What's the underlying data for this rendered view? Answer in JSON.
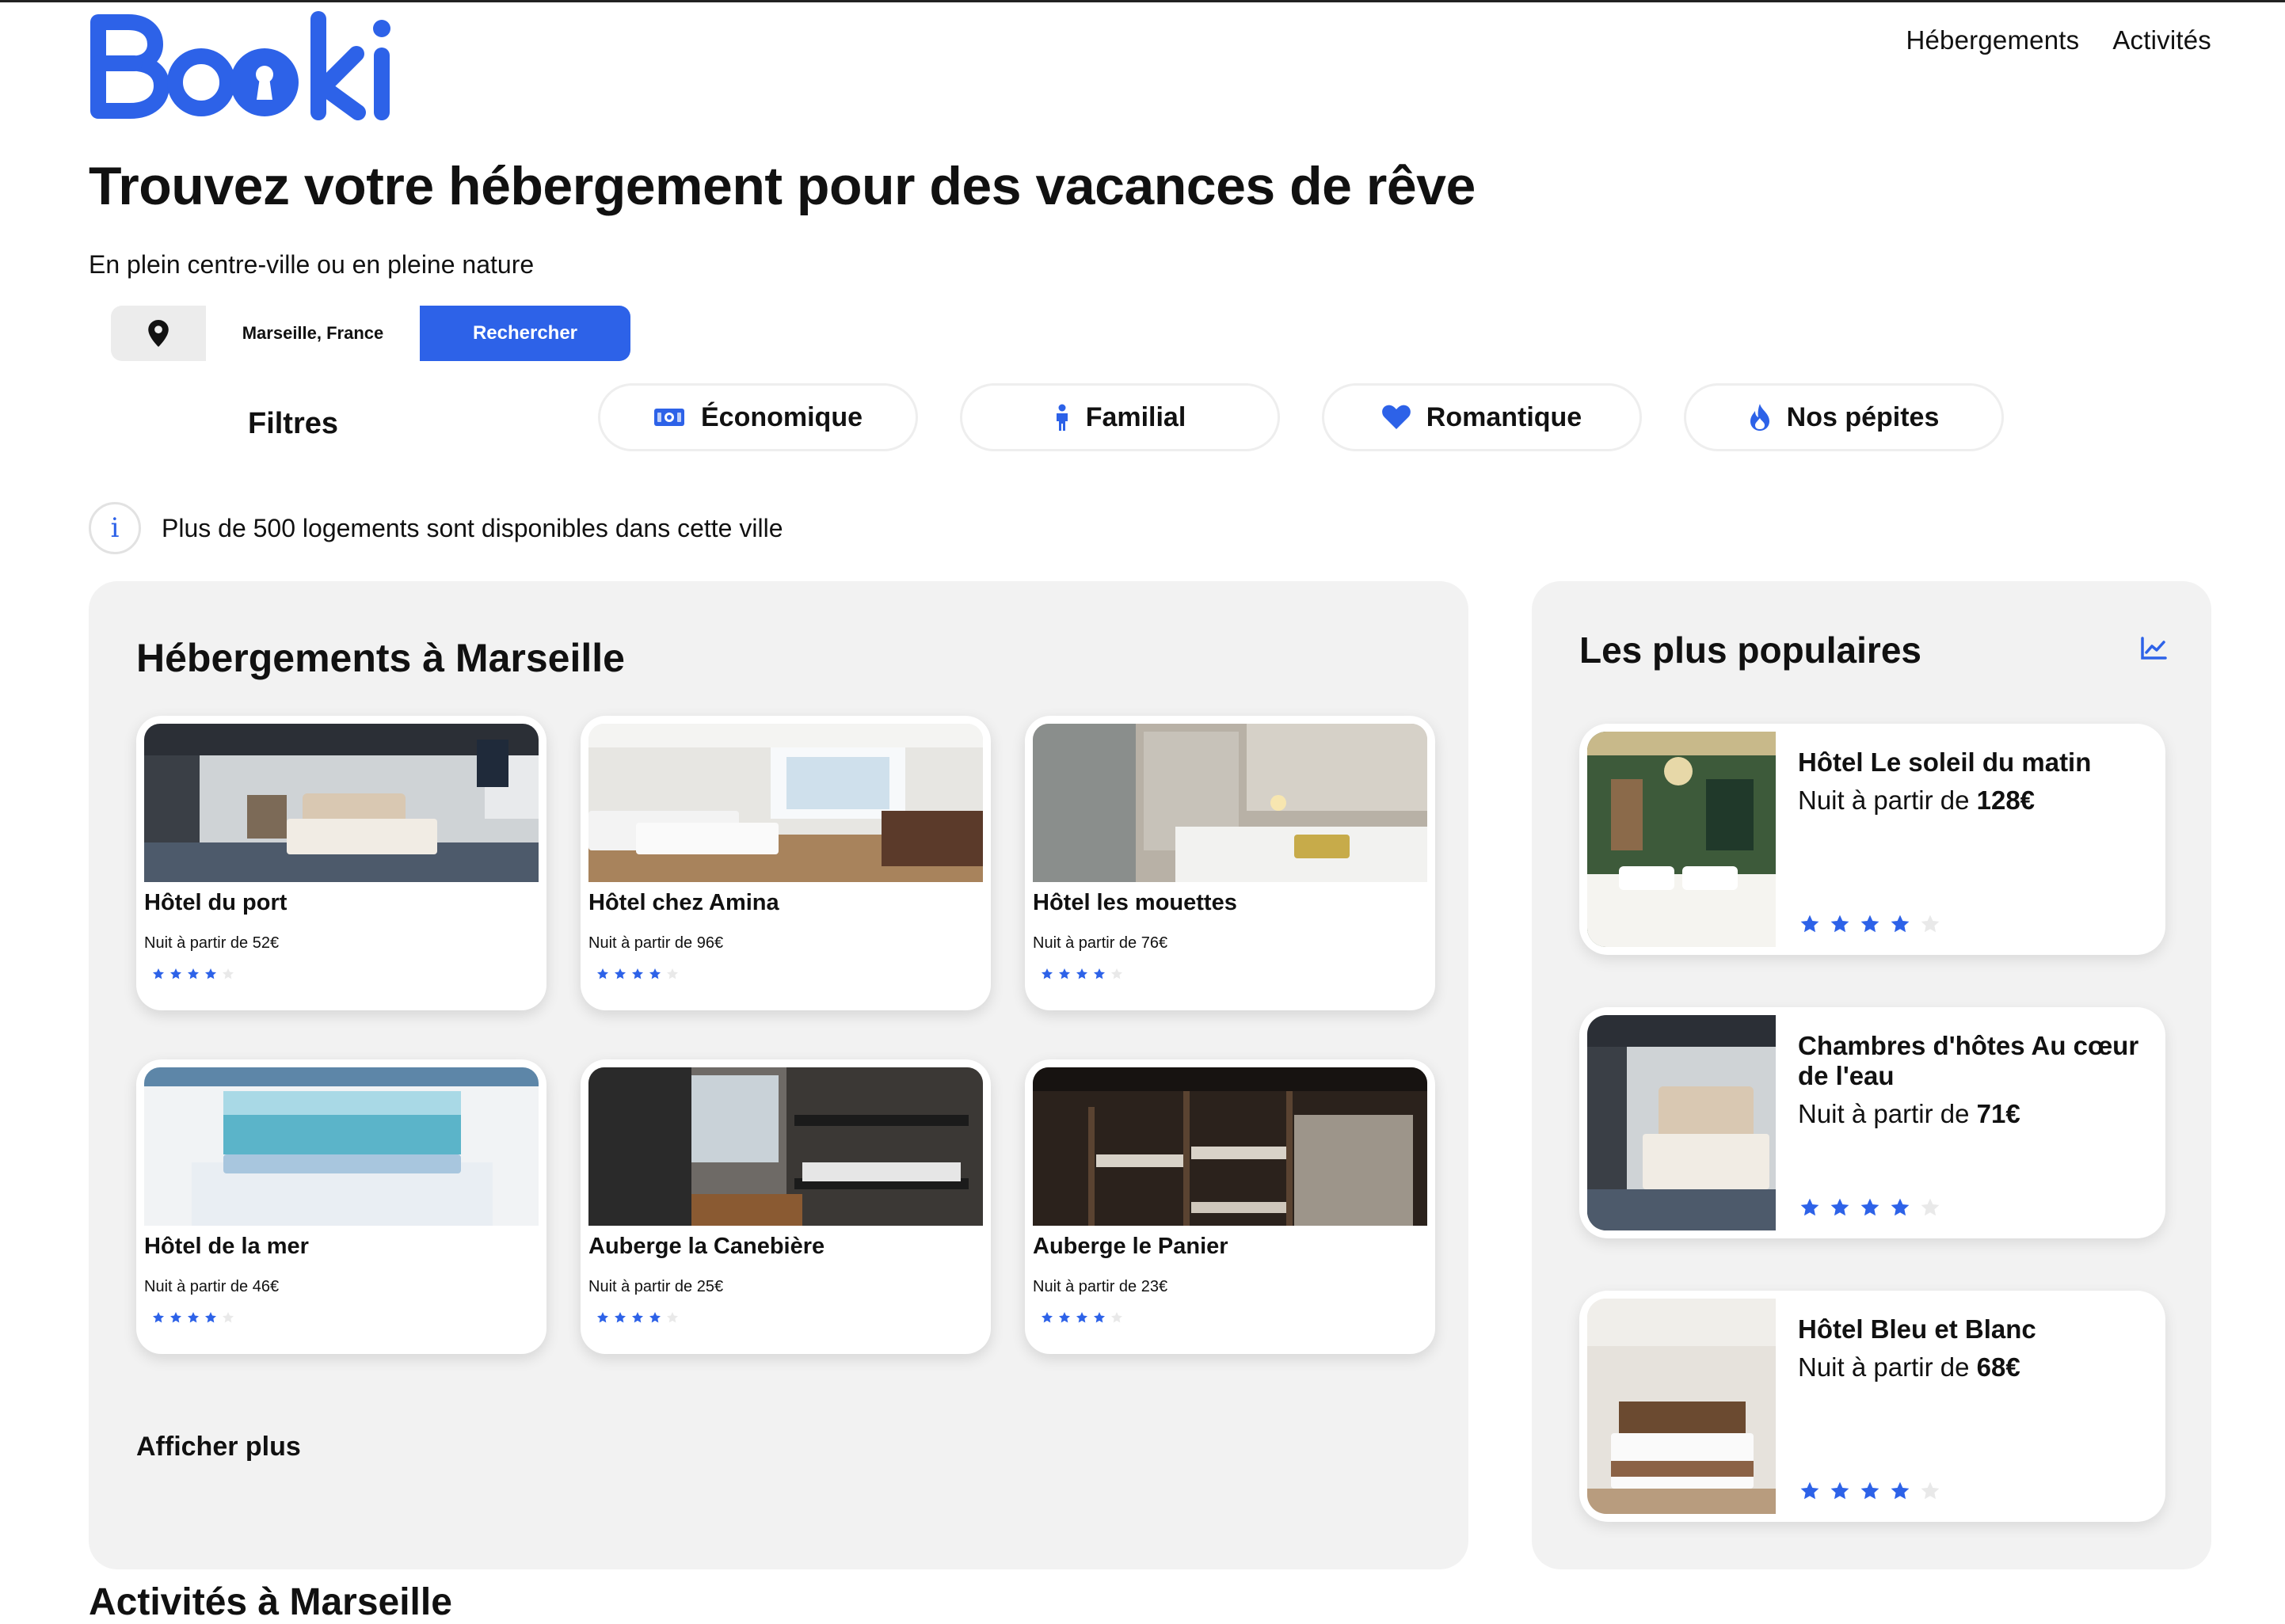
{
  "brand": {
    "logo_text": "Booki",
    "accent": "#2d62e8"
  },
  "nav": {
    "items": [
      "Hébergements",
      "Activités"
    ]
  },
  "hero": {
    "title": "Trouvez votre hébergement pour des vacances de rêve",
    "subtitle": "En plein centre-ville ou en pleine nature"
  },
  "search": {
    "value": "Marseille, France",
    "button": "Rechercher",
    "icon": "map-pin-icon"
  },
  "filters": {
    "label": "Filtres",
    "items": [
      {
        "label": "Économique",
        "icon": "money-icon"
      },
      {
        "label": "Familial",
        "icon": "person-icon"
      },
      {
        "label": "Romantique",
        "icon": "heart-icon"
      },
      {
        "label": "Nos pépites",
        "icon": "flame-icon"
      }
    ]
  },
  "info": {
    "text": "Plus de 500 logements sont disponibles dans cette ville",
    "icon": "info-icon"
  },
  "lodgings": {
    "title": "Hébergements à Marseille",
    "items": [
      {
        "name": "Hôtel du port",
        "price": "Nuit à partir de 52€",
        "rating": 4
      },
      {
        "name": "Hôtel chez Amina",
        "price": "Nuit à partir de 96€",
        "rating": 4
      },
      {
        "name": "Hôtel les mouettes",
        "price": "Nuit à partir de 76€",
        "rating": 4
      },
      {
        "name": "Hôtel de la mer",
        "price": "Nuit à partir de 46€",
        "rating": 4
      },
      {
        "name": "Auberge la Canebière",
        "price": "Nuit à partir de 25€",
        "rating": 4
      },
      {
        "name": "Auberge le Panier",
        "price": "Nuit à partir de 23€",
        "rating": 4
      }
    ],
    "more": "Afficher plus"
  },
  "popular": {
    "title": "Les plus populaires",
    "icon": "trend-chart-icon",
    "items": [
      {
        "name": "Hôtel Le soleil du matin",
        "price_prefix": "Nuit à partir de ",
        "price_value": "128€",
        "rating": 4
      },
      {
        "name": "Chambres d'hôtes Au cœur de l'eau",
        "price_prefix": "Nuit à partir de ",
        "price_value": "71€",
        "rating": 4
      },
      {
        "name": "Hôtel Bleu et Blanc",
        "price_prefix": "Nuit à partir de ",
        "price_value": "68€",
        "rating": 4
      }
    ]
  },
  "activities": {
    "title": "Activités à Marseille"
  }
}
